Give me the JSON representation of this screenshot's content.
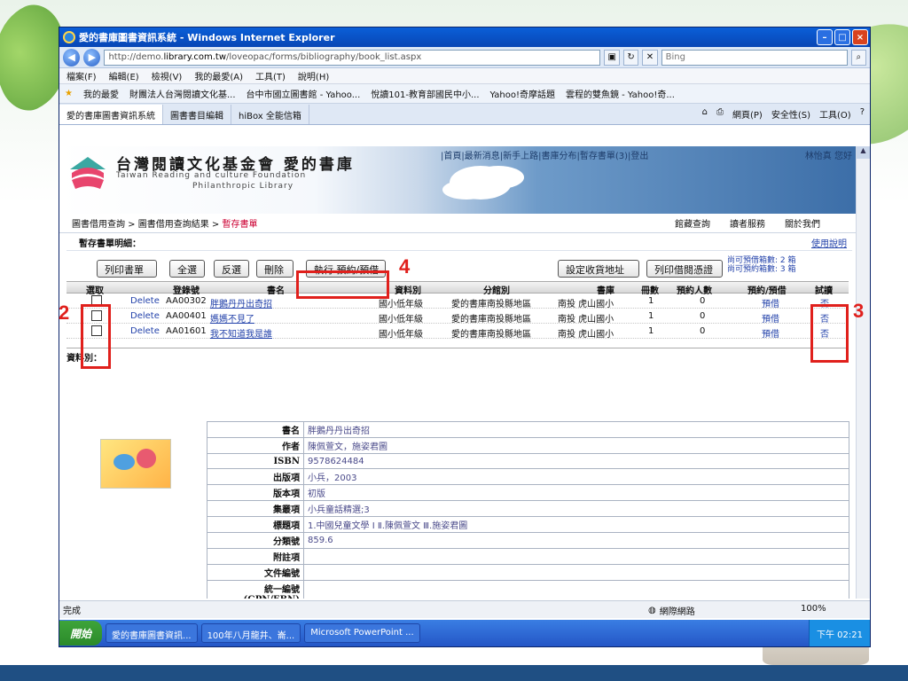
{
  "window": {
    "title": "愛的書庫圖書資訊系統 - Windows Internet Explorer",
    "controls": {
      "minimize": "–",
      "maximize": "□",
      "close": "×"
    }
  },
  "address": {
    "url_prefix": "http://demo.",
    "url_host": "library.com.tw",
    "url_path": "/loveopac/forms/bibliography/book_list.aspx",
    "search_placeholder": "Bing"
  },
  "menu": [
    "檔案(F)",
    "編輯(E)",
    "檢視(V)",
    "我的最愛(A)",
    "工具(T)",
    "說明(H)"
  ],
  "favorites": {
    "label": "我的最愛",
    "items": [
      "財團法人台灣閱讀文化基...",
      "台中市國立圖書館 - Yahoo...",
      "悅讀101-教育部國民中小...",
      "Yahoo!奇摩話題",
      "雲程的雙魚鏡 - Yahoo!奇..."
    ]
  },
  "tabs": [
    "愛的書庫圖書資訊系統",
    "圖書書目編輯",
    "hiBox 全能信箱"
  ],
  "tab_tools": [
    "網頁(P)",
    "安全性(S)",
    "工具(O)"
  ],
  "site": {
    "logo_title": "台灣閱讀文化基金會 愛的書庫",
    "logo_sub1": "Taiwan Reading and culture Foundation",
    "logo_sub2": "Philanthropic Library",
    "links": "|首頁|最新消息|新手上路|書庫分布|暫存書單(3)|登出",
    "user": "林怡真 您好"
  },
  "breadcrumb": {
    "part1": "圖書借用查詢 > 圖書借用查詢結果 > ",
    "current": "暫存書單",
    "right_nav": [
      "館藏查詢",
      "讀者服務",
      "關於我們"
    ]
  },
  "cart": {
    "title": "暫存書單明細：",
    "help": "使用說明"
  },
  "toolbar": {
    "print": "列印書單",
    "select_all": "全選",
    "invert": "反選",
    "delete": "刪除",
    "execute": "執行 預約/預借",
    "set_address": "設定收貨地址",
    "print_receipt": "列印借閱憑證",
    "quota_line1": "尚可預借箱數: 2 箱",
    "quota_line2": "尚可預約箱數: 3 箱"
  },
  "table": {
    "headers": [
      "選取",
      "登錄號",
      "書名",
      "資料別",
      "分館別",
      "書庫",
      "冊數",
      "預約人數",
      "預約/預借",
      "試讀"
    ],
    "rows": [
      {
        "delete": "Delete",
        "acc": "AA00302",
        "title": "胖鵝丹丹出奇招",
        "type": "國小低年級",
        "branch": "愛的書庫南投縣地區",
        "store": "南投 虎山國小",
        "vol": "1",
        "holds": "0",
        "action": "預借",
        "trial": "否"
      },
      {
        "delete": "Delete",
        "acc": "AA00401",
        "title": "媽媽不見了",
        "type": "國小低年級",
        "branch": "愛的書庫南投縣地區",
        "store": "南投 虎山國小",
        "vol": "1",
        "holds": "0",
        "action": "預借",
        "trial": "否"
      },
      {
        "delete": "Delete",
        "acc": "AA01601",
        "title": "我不知道我是誰",
        "type": "國小低年級",
        "branch": "愛的書庫南投縣地區",
        "store": "南投 虎山國小",
        "vol": "1",
        "holds": "0",
        "action": "預借",
        "trial": "否"
      }
    ]
  },
  "callouts": {
    "n2": "2",
    "n3": "3",
    "n4": "4"
  },
  "detail": {
    "section_label": "資料別：",
    "rows": [
      {
        "k": "書名",
        "v": "胖鵝丹丹出奇招"
      },
      {
        "k": "作者",
        "v": "陳佩萱文，施姿君圖"
      },
      {
        "k": "ISBN",
        "v": "9578624484"
      },
      {
        "k": "出版項",
        "v": "小兵，2003"
      },
      {
        "k": "版本項",
        "v": "初版"
      },
      {
        "k": "集叢項",
        "v": "小兵童話精選;3"
      },
      {
        "k": "標題項",
        "v": "1.中國兒童文學 I Ⅱ.陳佩萱文 Ⅲ.施姿君圖"
      },
      {
        "k": "分類號",
        "v": "859.6"
      },
      {
        "k": "附註項",
        "v": ""
      },
      {
        "k": "文件編號",
        "v": ""
      },
      {
        "k": "統一編號(GPN/EBN)",
        "v": ""
      }
    ]
  },
  "statusbar": {
    "text": "完成",
    "zone": "網際網路",
    "zoom": "100%"
  },
  "taskbar": {
    "start": "開始",
    "items": [
      "愛的書庫圖書資訊...",
      "100年八月龍井、崙...",
      "Microsoft PowerPoint ..."
    ],
    "clock": "下午 02:21"
  },
  "colors": {
    "callout_red": "#e0201c",
    "link_blue": "#2342aa",
    "titlebar_blue": "#0846b5"
  }
}
